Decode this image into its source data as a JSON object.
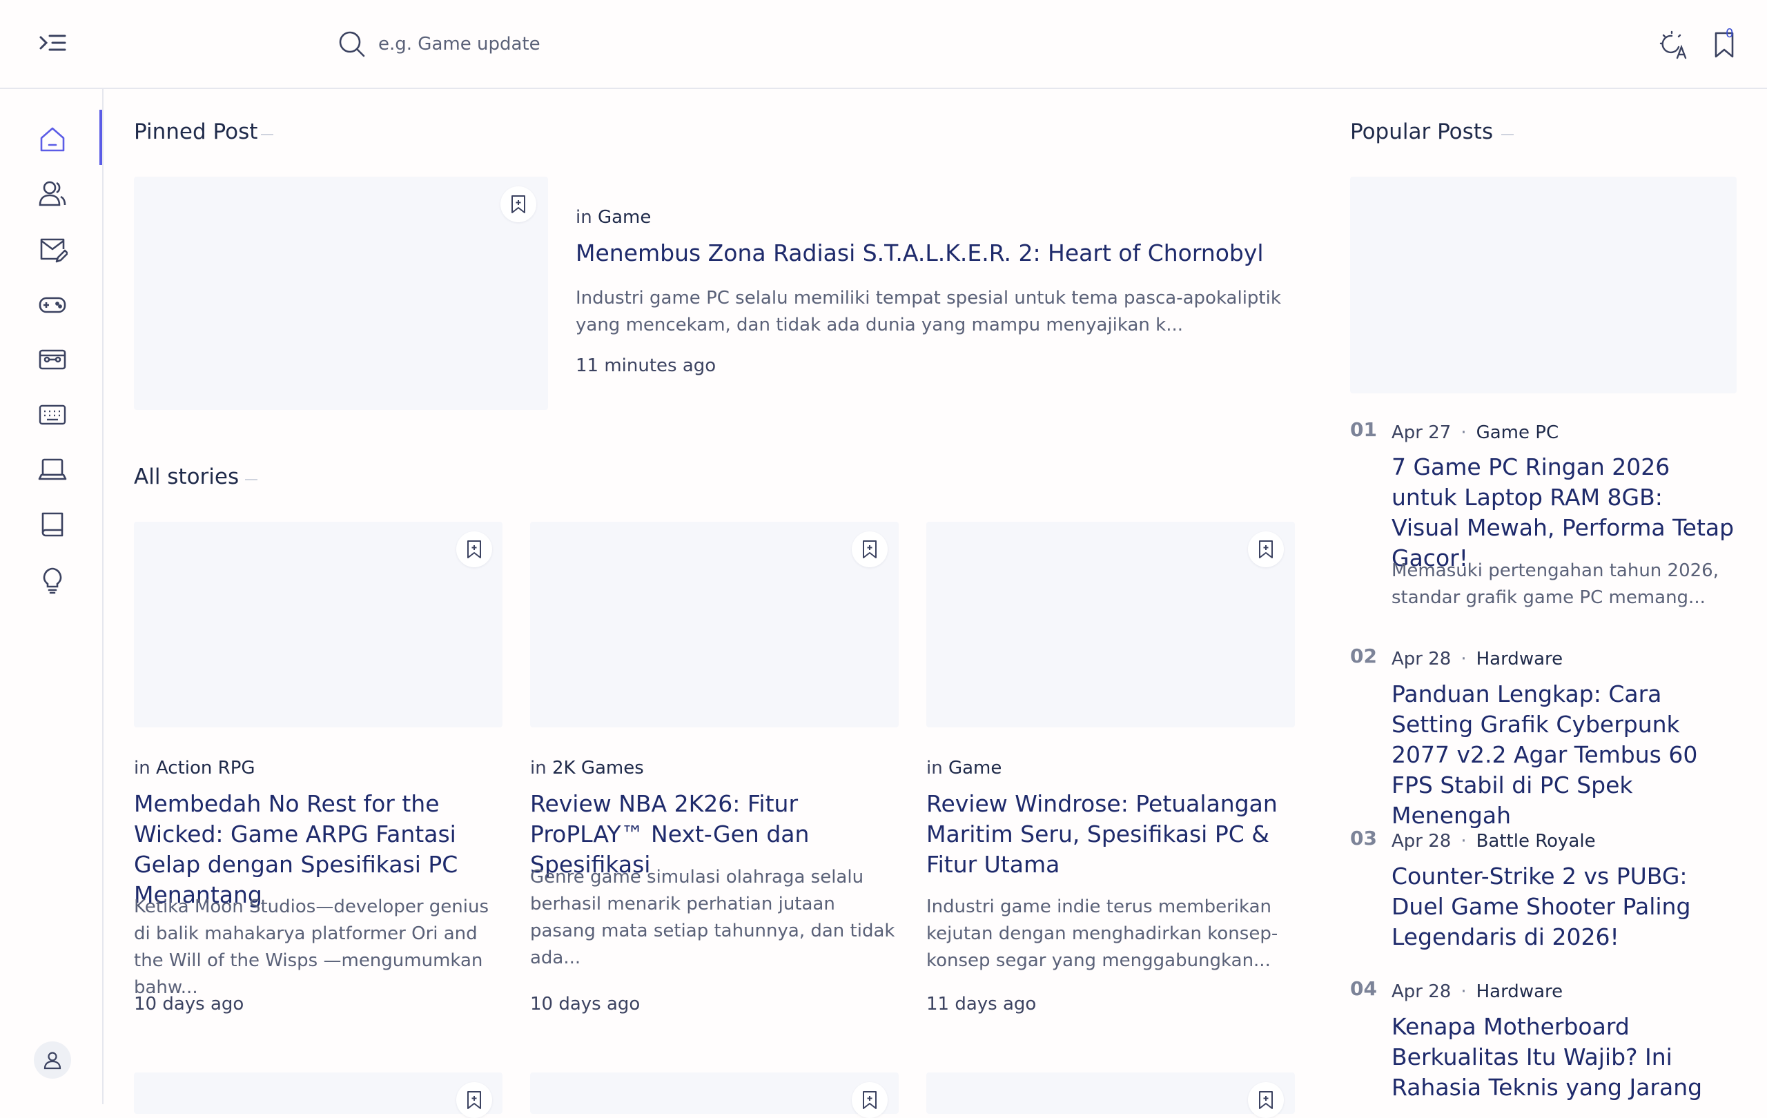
{
  "search": {
    "placeholder": "e.g. Game update"
  },
  "header": {
    "bookmark_count": "0"
  },
  "sidebar": {
    "items": [
      {
        "icon": "home-icon"
      },
      {
        "icon": "users-icon"
      },
      {
        "icon": "mail-edit-icon"
      },
      {
        "icon": "gamepad-icon"
      },
      {
        "icon": "ticket-icon"
      },
      {
        "icon": "keyboard-icon"
      },
      {
        "icon": "laptop-icon"
      },
      {
        "icon": "book-icon"
      },
      {
        "icon": "lightbulb-icon"
      }
    ]
  },
  "pinned": {
    "section_title": "Pinned Post",
    "in_label": "in",
    "category": "Game",
    "title": "Menembus Zona Radiasi S.T.A.L.K.E.R. 2: Heart of Chornobyl",
    "excerpt": "Industri game PC selalu memiliki tempat spesial untuk tema pasca-apokaliptik yang mencekam, dan tidak ada dunia yang mampu menyajikan k...",
    "time": "11 minutes ago"
  },
  "stories": {
    "section_title": "All stories",
    "in_label": "in",
    "cards": [
      {
        "category": "Action RPG",
        "title": "Membedah No Rest for the Wicked: Game ARPG Fantasi Gelap dengan Spesifikasi PC Menantang",
        "excerpt": "Ketika Moon Studios—developer genius di balik mahakarya platformer Ori and the Will of the Wisps —mengumumkan bahw...",
        "time": "10 days ago"
      },
      {
        "category": "2K Games",
        "title": "Review NBA 2K26: Fitur ProPLAY™ Next-Gen dan Spesifikasi",
        "excerpt": "Genre game simulasi olahraga selalu berhasil menarik perhatian jutaan pasang mata setiap tahunnya, dan tidak ada...",
        "time": "10 days ago"
      },
      {
        "category": "Game",
        "title": "Review Windrose: Petualangan Maritim Seru, Spesifikasi PC & Fitur Utama",
        "excerpt": "Industri game indie terus memberikan kejutan dengan menghadirkan konsep-konsep segar yang menggabungkan...",
        "time": "11 days ago"
      }
    ]
  },
  "popular": {
    "section_title": "Popular Posts",
    "items": [
      {
        "num": "01",
        "date": "Apr 27",
        "sep": "·",
        "category": "Game PC",
        "title": "7 Game PC Ringan 2026 untuk Laptop RAM 8GB: Visual Mewah, Performa Tetap Gacor!",
        "excerpt": "Memasuki pertengahan tahun 2026, standar grafik game PC memang..."
      },
      {
        "num": "02",
        "date": "Apr 28",
        "sep": "·",
        "category": "Hardware",
        "title": "Panduan Lengkap: Cara Setting Grafik Cyberpunk 2077 v2.2 Agar Tembus 60 FPS Stabil di PC Spek Menengah"
      },
      {
        "num": "03",
        "date": "Apr 28",
        "sep": "·",
        "category": "Battle Royale",
        "title": "Counter-Strike 2 vs PUBG: Duel Game Shooter Paling Legendaris di 2026!"
      },
      {
        "num": "04",
        "date": "Apr 28",
        "sep": "·",
        "category": "Hardware",
        "title": "Kenapa Motherboard Berkualitas Itu Wajib? Ini Rahasia Teknis yang Jarang"
      }
    ]
  }
}
